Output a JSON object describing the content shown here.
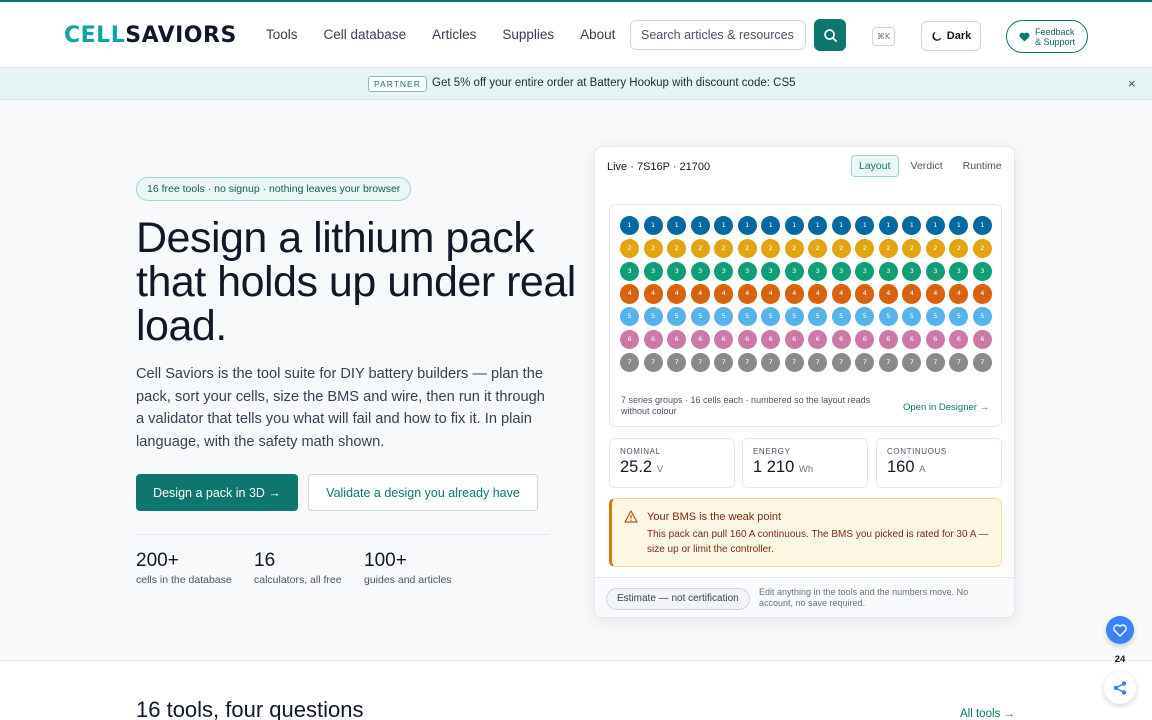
{
  "brand": {
    "part1": "CELL",
    "part2": "SAVIORS"
  },
  "nav": [
    "Tools",
    "Cell database",
    "Articles",
    "Supplies",
    "About"
  ],
  "search": {
    "placeholder": "Search articles & resources…"
  },
  "shortcut": "⌘K",
  "theme_label": "Dark",
  "feedback": {
    "line1": "Feedback",
    "line2": "& Support"
  },
  "banner": {
    "tag": "PARTNER",
    "text": "Get 5% off your entire order at Battery Hookup with discount code: CS5",
    "close": "×"
  },
  "hero": {
    "pill": "16 free tools · no signup · nothing leaves your browser",
    "title": "Design a lithium pack that holds up under real load.",
    "lead": "Cell Saviors is the tool suite for DIY battery builders — plan the pack, sort your cells, size the BMS and wire, then run it through a validator that tells you what will fail and how to fix it. In plain language, with the safety math shown.",
    "primary_cta": "Design a pack in 3D →",
    "secondary_cta": "Validate a design you already have",
    "stats": [
      {
        "value": "200+",
        "label": "cells in the database"
      },
      {
        "value": "16",
        "label": "calculators, all free"
      },
      {
        "value": "100+",
        "label": "guides and articles"
      }
    ]
  },
  "card": {
    "heading": "Live · 7S16P · 21700",
    "tabs": [
      "Layout",
      "Verdict",
      "Runtime"
    ],
    "active_tab": "Layout",
    "grid": {
      "series": 7,
      "parallel": 16,
      "colors": [
        "#0369a1",
        "#e2a50f",
        "#0f9e75",
        "#d9620f",
        "#56b4e9",
        "#cc79a7",
        "#8a8a8a"
      ],
      "note": "7 series groups · 16 cells each · numbered so the layout reads without colour",
      "link": "Open in Designer →"
    },
    "metrics": [
      {
        "key": "NOMINAL",
        "value": "25.2",
        "unit": "V"
      },
      {
        "key": "ENERGY",
        "value": "1 210",
        "unit": "Wh"
      },
      {
        "key": "CONTINUOUS",
        "value": "160",
        "unit": "A"
      }
    ],
    "warning": {
      "title": "Your BMS is the weak point",
      "body": "This pack can pull 160 A continuous. The BMS you picked is rated for 30 A — size up or limit the controller."
    },
    "footer": {
      "badge": "Estimate — not certification",
      "note": "Edit anything in the tools and the numbers move. No account, no save required."
    }
  },
  "section": {
    "title": "16 tools, four questions",
    "link": "All tools →"
  },
  "floating": {
    "count": "24"
  }
}
